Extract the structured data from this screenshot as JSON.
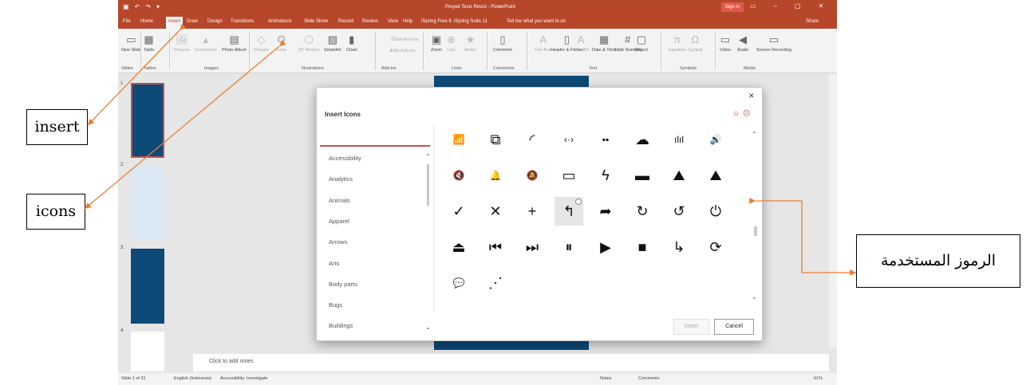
{
  "titlebar": {
    "doc_title": "Proyek Tesis Revisi - PowerPoint",
    "signin": "Sign in",
    "qat_icons": [
      "save-icon",
      "undo-icon",
      "redo-icon",
      "customize-icon"
    ]
  },
  "tabs": [
    {
      "label": "File",
      "active": false
    },
    {
      "label": "Home",
      "active": false
    },
    {
      "label": "Insert",
      "active": true
    },
    {
      "label": "Draw",
      "active": false
    },
    {
      "label": "Design",
      "active": false
    },
    {
      "label": "Transitions",
      "active": false
    },
    {
      "label": "Animations",
      "active": false
    },
    {
      "label": "Slide Show",
      "active": false
    },
    {
      "label": "Record",
      "active": false
    },
    {
      "label": "Review",
      "active": false
    },
    {
      "label": "View",
      "active": false
    },
    {
      "label": "Help",
      "active": false
    },
    {
      "label": "iSpring Free 9",
      "active": false
    },
    {
      "label": "iSpring Suite 11",
      "active": false
    },
    {
      "label": "Tell me what you want to do",
      "active": false
    }
  ],
  "share": "Share",
  "ribbon": {
    "buttons": [
      {
        "label": "New Slide",
        "icon": "new-slide-icon",
        "glyph": "▭",
        "dim": false
      },
      {
        "label": "Table",
        "icon": "table-icon",
        "glyph": "▦",
        "dim": false
      },
      {
        "label": "Pictures",
        "icon": "pictures-icon",
        "glyph": "🖼",
        "dim": true
      },
      {
        "label": "Screenshot",
        "icon": "screenshot-icon",
        "glyph": "▴",
        "dim": true
      },
      {
        "label": "Photo Album",
        "icon": "photo-album-icon",
        "glyph": "▤",
        "dim": false
      },
      {
        "label": "Shapes",
        "icon": "shapes-icon",
        "glyph": "◇",
        "dim": true
      },
      {
        "label": "Icons",
        "icon": "icons-icon",
        "glyph": "✪",
        "dim": true
      },
      {
        "label": "3D Models",
        "icon": "3d-models-icon",
        "glyph": "⬡",
        "dim": true
      },
      {
        "label": "SmartArt",
        "icon": "smartart-icon",
        "glyph": "▧",
        "dim": false
      },
      {
        "label": "Chart",
        "icon": "chart-icon",
        "glyph": "▮",
        "dim": false
      },
      {
        "label": "Get Add-ins",
        "icon": "get-addins-icon",
        "glyph": "⊞",
        "dim": true
      },
      {
        "label": "My Add-ins",
        "icon": "my-addins-icon",
        "glyph": "◈",
        "dim": true
      },
      {
        "label": "Zoom",
        "icon": "zoom-icon",
        "glyph": "▣",
        "dim": false
      },
      {
        "label": "Link",
        "icon": "link-icon",
        "glyph": "⊕",
        "dim": true
      },
      {
        "label": "Action",
        "icon": "action-icon",
        "glyph": "★",
        "dim": true
      },
      {
        "label": "Comment",
        "icon": "comment-icon",
        "glyph": "▯",
        "dim": false
      },
      {
        "label": "Text Box",
        "icon": "text-box-icon",
        "glyph": "A",
        "dim": true
      },
      {
        "label": "Header & Footer",
        "icon": "header-footer-icon",
        "glyph": "▯",
        "dim": false
      },
      {
        "label": "WordArt",
        "icon": "wordart-icon",
        "glyph": "A",
        "dim": true
      },
      {
        "label": "Date & Time",
        "icon": "date-time-icon",
        "glyph": "▦",
        "dim": false
      },
      {
        "label": "Slide Number",
        "icon": "slide-number-icon",
        "glyph": "#",
        "dim": false
      },
      {
        "label": "Object",
        "icon": "object-icon",
        "glyph": "▢",
        "dim": false
      },
      {
        "label": "Equation",
        "icon": "equation-icon",
        "glyph": "π",
        "dim": true
      },
      {
        "label": "Symbol",
        "icon": "symbol-icon",
        "glyph": "Ω",
        "dim": true
      },
      {
        "label": "Video",
        "icon": "video-icon",
        "glyph": "▭",
        "dim": false
      },
      {
        "label": "Audio",
        "icon": "audio-icon",
        "glyph": "◀",
        "dim": false
      },
      {
        "label": "Screen Recording",
        "icon": "screen-recording-icon",
        "glyph": "▭",
        "dim": false
      }
    ],
    "groups": [
      "Slides",
      "Tables",
      "Images",
      "Illustrations",
      "Add-ins",
      "Links",
      "Comments",
      "Text",
      "Symbols",
      "Media"
    ]
  },
  "slides": [
    "1",
    "2",
    "3",
    "4"
  ],
  "notes_placeholder": "Click to add notes",
  "status": {
    "slide_info": "Slide 1 of 31",
    "language": "English (Indonesia)",
    "accessibility": "Accessibility: Investigate",
    "notes": "Notes",
    "comments": "Comments",
    "zoom": "61%"
  },
  "dialog": {
    "title": "Insert Icons",
    "categories": [
      "Accessibility",
      "Analytics",
      "Animals",
      "Apparel",
      "Arrows",
      "Arts",
      "Body parts",
      "Bugs",
      "Buildings"
    ],
    "icons": [
      {
        "name": "wifi-icon",
        "glyph": "📶"
      },
      {
        "name": "screen-share-icon",
        "glyph": "⧉"
      },
      {
        "name": "wireless-signal-icon",
        "glyph": "◜"
      },
      {
        "name": "code-arrows-icon",
        "glyph": "‹·›"
      },
      {
        "name": "connector-icon",
        "glyph": "▪▪"
      },
      {
        "name": "cloud-sync-icon",
        "glyph": "☁"
      },
      {
        "name": "sound-wave-icon",
        "glyph": "ılıl"
      },
      {
        "name": "speaker-icon",
        "glyph": "🔊"
      },
      {
        "name": "mute-icon",
        "glyph": "🔇"
      },
      {
        "name": "bell-icon",
        "glyph": "🔔"
      },
      {
        "name": "bell-off-icon",
        "glyph": "🔕"
      },
      {
        "name": "battery-empty-icon",
        "glyph": "▭"
      },
      {
        "name": "battery-charging-icon",
        "glyph": "ϟ"
      },
      {
        "name": "battery-full-icon",
        "glyph": "▬"
      },
      {
        "name": "image-icon",
        "glyph": "⛰"
      },
      {
        "name": "images-icon",
        "glyph": "⛰"
      },
      {
        "name": "checkmark-icon",
        "glyph": "✓"
      },
      {
        "name": "close-x-icon",
        "glyph": "✕"
      },
      {
        "name": "plus-icon",
        "glyph": "+"
      },
      {
        "name": "reply-arrow-icon",
        "glyph": "↰",
        "selected": true
      },
      {
        "name": "forward-arrow-icon",
        "glyph": "➦"
      },
      {
        "name": "rotate-right-icon",
        "glyph": "↻"
      },
      {
        "name": "rotate-left-icon",
        "glyph": "↺"
      },
      {
        "name": "power-icon",
        "glyph": "⏻"
      },
      {
        "name": "eject-icon",
        "glyph": "⏏"
      },
      {
        "name": "previous-track-icon",
        "glyph": "⏮"
      },
      {
        "name": "next-track-icon",
        "glyph": "⏭"
      },
      {
        "name": "pause-icon",
        "glyph": "⏸"
      },
      {
        "name": "play-icon",
        "glyph": "▶"
      },
      {
        "name": "stop-icon",
        "glyph": "■"
      },
      {
        "name": "return-arrow-icon",
        "glyph": "↳"
      },
      {
        "name": "refresh-icon",
        "glyph": "⟳"
      },
      {
        "name": "chat-bubble-icon",
        "glyph": "💬"
      },
      {
        "name": "share-nodes-icon",
        "glyph": "⋰"
      }
    ],
    "insert_label": "Insert",
    "cancel_label": "Cancel"
  },
  "annotations": {
    "insert": "insert",
    "icons": "icons",
    "symbols": "الرموز المستخدمة"
  },
  "colors": {
    "accent": "#b7472a",
    "slide_bg": "#0d4a78",
    "arrow": "#ed7d31"
  }
}
